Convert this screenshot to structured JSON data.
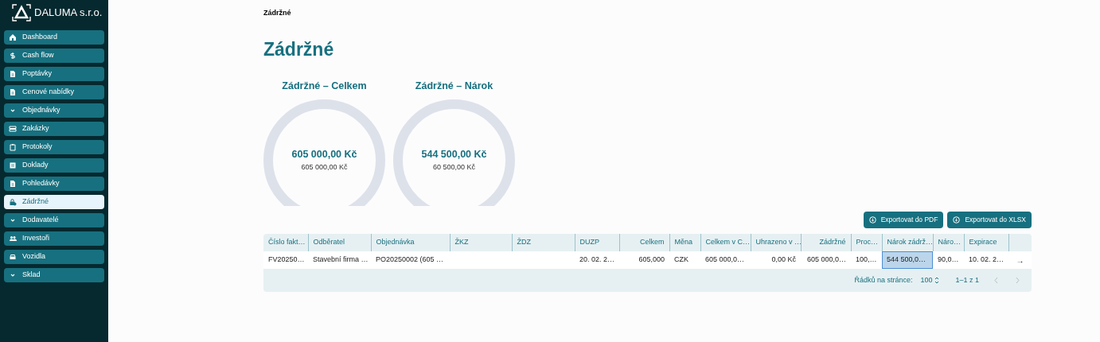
{
  "sidebar": {
    "logo": "DALUMA s.r.o.",
    "items": [
      {
        "label": "Dashboard",
        "kind": "home",
        "selected": false
      },
      {
        "label": "Cash flow",
        "kind": "dollar",
        "selected": false
      },
      {
        "label": "Poptávky",
        "kind": "doc",
        "selected": false
      },
      {
        "label": "Cenové nabídky",
        "kind": "doc",
        "selected": false
      },
      {
        "label": "Objednávky",
        "kind": "chevron",
        "selected": false
      },
      {
        "label": "Zakázky",
        "kind": "tray",
        "selected": false
      },
      {
        "label": "Protokoly",
        "kind": "clipboard",
        "selected": false
      },
      {
        "label": "Doklady",
        "kind": "list",
        "selected": false
      },
      {
        "label": "Pohledávky",
        "kind": "doc",
        "selected": false
      },
      {
        "label": "Zádržné",
        "kind": "lock",
        "selected": true
      },
      {
        "label": "Dodavatelé",
        "kind": "chevron",
        "selected": false
      },
      {
        "label": "Investoři",
        "kind": "people",
        "selected": false
      },
      {
        "label": "Vozidla",
        "kind": "car",
        "selected": false
      },
      {
        "label": "Sklad",
        "kind": "chevron",
        "selected": false
      }
    ]
  },
  "breadcrumb": "Zádržné",
  "title": "Zádržné",
  "gauges": [
    {
      "title": "Zádržné – Celkem",
      "value": "605 000,00 Kč",
      "subvalue": "605 000,00 Kč"
    },
    {
      "title": "Zádržné – Nárok",
      "value": "544 500,00 Kč",
      "subvalue": "60 500,00 Kč"
    }
  ],
  "export_buttons": [
    "Exportovat do PDF",
    "Exportovat do XLSX"
  ],
  "table": {
    "columns": [
      "Číslo fakt…",
      "Odběratel",
      "Objednávka",
      "ŽKZ",
      "ŽDZ",
      "DUZP",
      "Celkem",
      "Měna",
      "Celkem v C…",
      "Uhrazeno v …",
      "Zádržné",
      "Proc…",
      "Nárok zádrž…",
      "Náro…",
      "Expirace"
    ],
    "rows": [
      {
        "cells": [
          {
            "text": "FV20250…",
            "selected": false
          },
          {
            "text": "Stavební firma …",
            "selected": false
          },
          {
            "text": "PO20250002 (605 …",
            "selected": false
          },
          {
            "text": "",
            "selected": false
          },
          {
            "text": "",
            "selected": false
          },
          {
            "text": "20. 02. 2…",
            "selected": false
          },
          {
            "text": "605,000",
            "selected": false
          },
          {
            "text": "CZK",
            "selected": false
          },
          {
            "text": "605 000,0…",
            "selected": false
          },
          {
            "text": "0,00 Kč",
            "selected": false
          },
          {
            "text": "605 000,0…",
            "selected": false
          },
          {
            "text": "100,…",
            "selected": false
          },
          {
            "text": "544 500,0…",
            "selected": true
          },
          {
            "text": "90,0…",
            "selected": false
          },
          {
            "text": "10. 02. 2…",
            "selected": false
          }
        ],
        "action": "→"
      }
    ],
    "footer": {
      "rows_label": "Řádků na stránce:",
      "rows_value": "100",
      "range": "1–1 z 1"
    }
  }
}
